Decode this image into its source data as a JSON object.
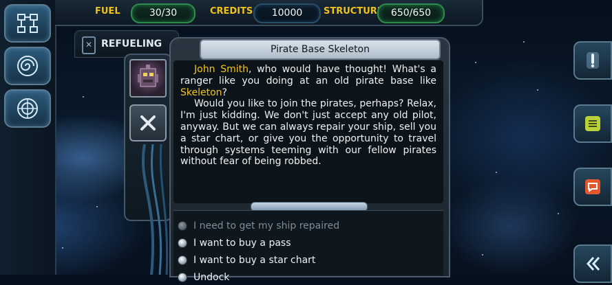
{
  "status": {
    "fuel_label": "FUEL",
    "fuel_value": "30/30",
    "credits_label": "CREDITS",
    "credits_value": "10000",
    "structure_label": "STRUCTURE",
    "structure_value": "650/650"
  },
  "tab": {
    "label": "REFUELING"
  },
  "dialog": {
    "title": "Pirate Base Skeleton",
    "p1_name": "John Smith",
    "p1_a": ", who would have thought! What's a ranger like you doing at an old pirate base like ",
    "p1_place": "Skeleton",
    "p1_b": "?",
    "p2": "Would you like to join the pirates, perhaps? Relax, I'm just kidding. We don't just accept any old pilot, anyway. But we can always repair your ship, sell you a star chart, or give you the opportunity to travel through systems teeming with our fellow pirates without fear of being robbed."
  },
  "options": [
    {
      "label": "I need to get my ship repaired",
      "enabled": false
    },
    {
      "label": "I want to buy a pass",
      "enabled": true
    },
    {
      "label": "I want to buy a star chart",
      "enabled": true
    },
    {
      "label": "Undock",
      "enabled": true
    }
  ],
  "colors": {
    "highlight": "#f4c41c",
    "stat_label": "#f0c21a"
  }
}
